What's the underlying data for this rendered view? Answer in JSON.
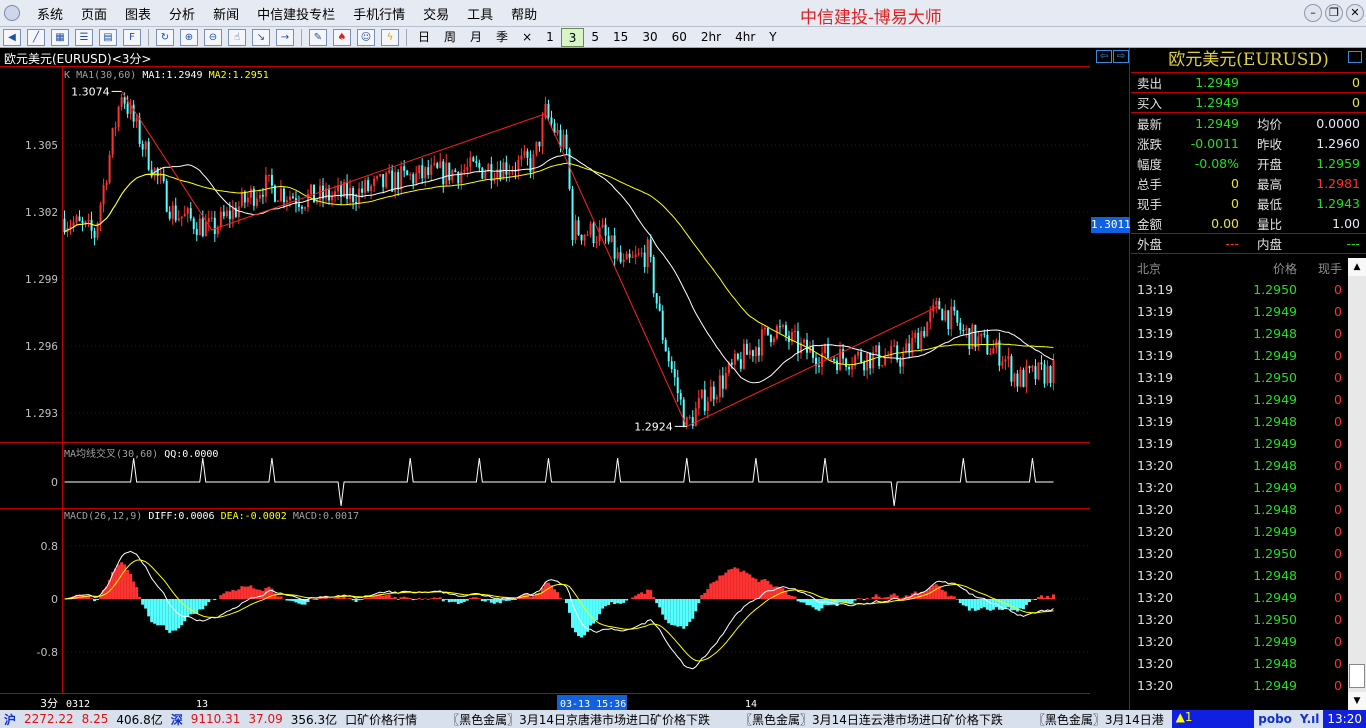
{
  "menu": {
    "items": [
      "系统",
      "页面",
      "图表",
      "分析",
      "新闻",
      "中信建投专栏",
      "手机行情",
      "交易",
      "工具",
      "帮助"
    ],
    "brand": "中信建投-博易大师"
  },
  "toolbar": {
    "periods": [
      "日",
      "周",
      "月",
      "季",
      "×",
      "1",
      "3",
      "5",
      "15",
      "30",
      "60",
      "2hr",
      "4hr",
      "Y"
    ],
    "active_period": "3"
  },
  "chart_title": "欧元美元(EURUSD)<3分>",
  "main_legend": {
    "k": "K",
    "ma": "MA1(30,60)",
    "ma1": "MA1:1.2949",
    "ma2": "MA2:1.2951"
  },
  "qq_legend": {
    "name": "MA均线交叉(30,60)",
    "qq": "QQ:0.0000"
  },
  "macd_legend": {
    "name": "MACD(26,12,9)",
    "diff": "DIFF:0.0006",
    "dea": "DEA:-0.0002",
    "macd": "MACD:0.0017"
  },
  "current_price_tag": "1.3011",
  "time_axis": {
    "period": "3分",
    "labels": [
      "0312",
      "13",
      "03-13 15:36",
      "14"
    ]
  },
  "chart_data": {
    "type": "candlestick",
    "bars": 330,
    "price_axis": {
      "ticks": [
        "1.305",
        "1.302",
        "1.299",
        "1.296",
        "1.293"
      ],
      "range": [
        1.2915,
        1.3085
      ]
    },
    "max_label": "1.3074",
    "min_label": "1.2924",
    "price_path": [
      [
        0,
        1.3017
      ],
      [
        10,
        1.301
      ],
      [
        19,
        1.3074
      ],
      [
        26,
        1.305
      ],
      [
        36,
        1.302
      ],
      [
        49,
        1.3012
      ],
      [
        66,
        1.3032
      ],
      [
        79,
        1.3026
      ],
      [
        96,
        1.3028
      ],
      [
        112,
        1.3035
      ],
      [
        129,
        1.3038
      ],
      [
        156,
        1.3042
      ],
      [
        160,
        1.3064
      ],
      [
        167,
        1.3047
      ],
      [
        169,
        1.3012
      ],
      [
        179,
        1.301
      ],
      [
        186,
        1.2995
      ],
      [
        194,
        1.3002
      ],
      [
        199,
        1.2965
      ],
      [
        207,
        1.2924
      ],
      [
        212,
        1.2935
      ],
      [
        226,
        1.2955
      ],
      [
        236,
        1.2968
      ],
      [
        246,
        1.2958
      ],
      [
        256,
        1.2955
      ],
      [
        279,
        1.2955
      ],
      [
        291,
        1.2978
      ],
      [
        299,
        1.2966
      ],
      [
        312,
        1.2956
      ],
      [
        317,
        1.2945
      ],
      [
        330,
        1.2949
      ]
    ],
    "zigzag": [
      [
        19,
        1.3074
      ],
      [
        49,
        1.3012
      ],
      [
        160,
        1.3064
      ],
      [
        207,
        1.2924
      ],
      [
        291,
        1.2978
      ]
    ],
    "ma_periods": [
      30,
      60
    ],
    "qq_axis": [
      "0"
    ],
    "macd_axis": {
      "ticks": [
        "0.8",
        "0",
        "-0.8"
      ]
    },
    "colors": {
      "up": "#ff3232",
      "down": "#54ffff",
      "ma1": "#ffffff",
      "ma2": "#ffff00",
      "zigzag": "#ff2020"
    }
  },
  "quote": {
    "title": "欧元美元(EURUSD)",
    "sell": {
      "label": "卖出",
      "price": "1.2949",
      "vol": "0"
    },
    "buy": {
      "label": "买入",
      "price": "1.2949",
      "vol": "0"
    },
    "rows": [
      {
        "k": "最新",
        "v": "1.2949",
        "k2": "均价",
        "v2": "0.0000"
      },
      {
        "k": "涨跌",
        "v": "-0.0011",
        "k2": "昨收",
        "v2": "1.2960"
      },
      {
        "k": "幅度",
        "v": "-0.08%",
        "k2": "开盘",
        "v2": "1.2959"
      },
      {
        "k": "总手",
        "v": "0",
        "k2": "最高",
        "v2": "1.2981"
      },
      {
        "k": "现手",
        "v": "0",
        "k2": "最低",
        "v2": "1.2943"
      },
      {
        "k": "金额",
        "v": "0.00",
        "k2": "量比",
        "v2": "1.00"
      }
    ],
    "outer": {
      "k": "外盘",
      "v": "---",
      "k2": "内盘",
      "v2": "---"
    }
  },
  "ticks": {
    "headers": [
      "北京",
      "价格",
      "现手"
    ],
    "rows": [
      [
        "13:19",
        "1.2950",
        "0"
      ],
      [
        "13:19",
        "1.2949",
        "0"
      ],
      [
        "13:19",
        "1.2948",
        "0"
      ],
      [
        "13:19",
        "1.2949",
        "0"
      ],
      [
        "13:19",
        "1.2950",
        "0"
      ],
      [
        "13:19",
        "1.2949",
        "0"
      ],
      [
        "13:19",
        "1.2948",
        "0"
      ],
      [
        "13:19",
        "1.2949",
        "0"
      ],
      [
        "13:20",
        "1.2948",
        "0"
      ],
      [
        "13:20",
        "1.2949",
        "0"
      ],
      [
        "13:20",
        "1.2948",
        "0"
      ],
      [
        "13:20",
        "1.2949",
        "0"
      ],
      [
        "13:20",
        "1.2950",
        "0"
      ],
      [
        "13:20",
        "1.2948",
        "0"
      ],
      [
        "13:20",
        "1.2949",
        "0"
      ],
      [
        "13:20",
        "1.2950",
        "0"
      ],
      [
        "13:20",
        "1.2949",
        "0"
      ],
      [
        "13:20",
        "1.2948",
        "0"
      ],
      [
        "13:20",
        "1.2949",
        "0"
      ]
    ]
  },
  "status": {
    "sh": "沪",
    "sh_idx": "2272.22",
    "sh_chg": "8.25",
    "sh_amt": "406.8亿",
    "sz": "深",
    "sz_idx": "9110.31",
    "sz_chg": "37.09",
    "sz_amt": "356.3亿",
    "news": "口矿价格行情　　　〖黑色金属〗3月14日京唐港市场进口矿价格下跌　　　〖黑色金属〗3月14日连云港市场进口矿价格下跌　　　〖黑色金属〗3月14日港",
    "alert": "▲1",
    "pobo": "pobo",
    "signal": "Y.ıl",
    "time": "13:20"
  }
}
